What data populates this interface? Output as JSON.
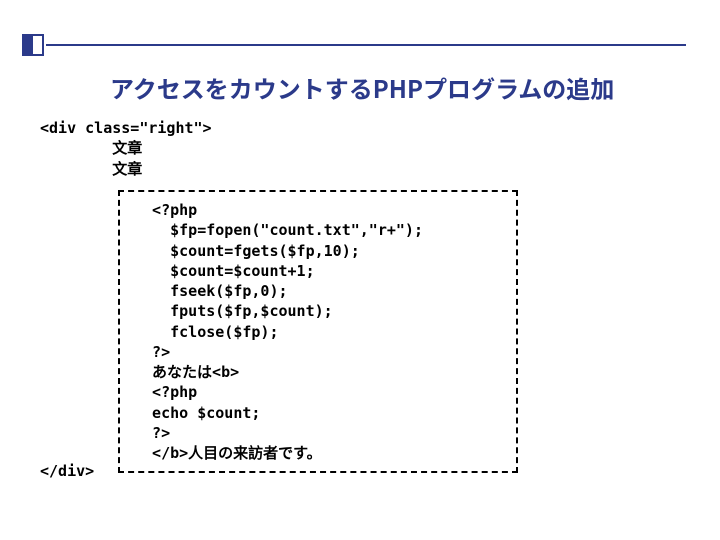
{
  "title": "アクセスをカウントするPHPプログラムの追加",
  "outer": {
    "line1": "<div class=\"right\">",
    "line2": "        文章",
    "line3": "        文章",
    "close": "</div>"
  },
  "box": {
    "l1": "  <?php",
    "l2": "    $fp=fopen(\"count.txt\",\"r+\");",
    "l3": "    $count=fgets($fp,10);",
    "l4": "    $count=$count+1;",
    "l5": "    fseek($fp,0);",
    "l6": "    fputs($fp,$count);",
    "l7": "    fclose($fp);",
    "l8": "  ?>",
    "l9": "  あなたは<b>",
    "l10": "  <?php",
    "l11": "  echo $count;",
    "l12": "  ?>",
    "l13": "  </b>人目の来訪者です。"
  }
}
